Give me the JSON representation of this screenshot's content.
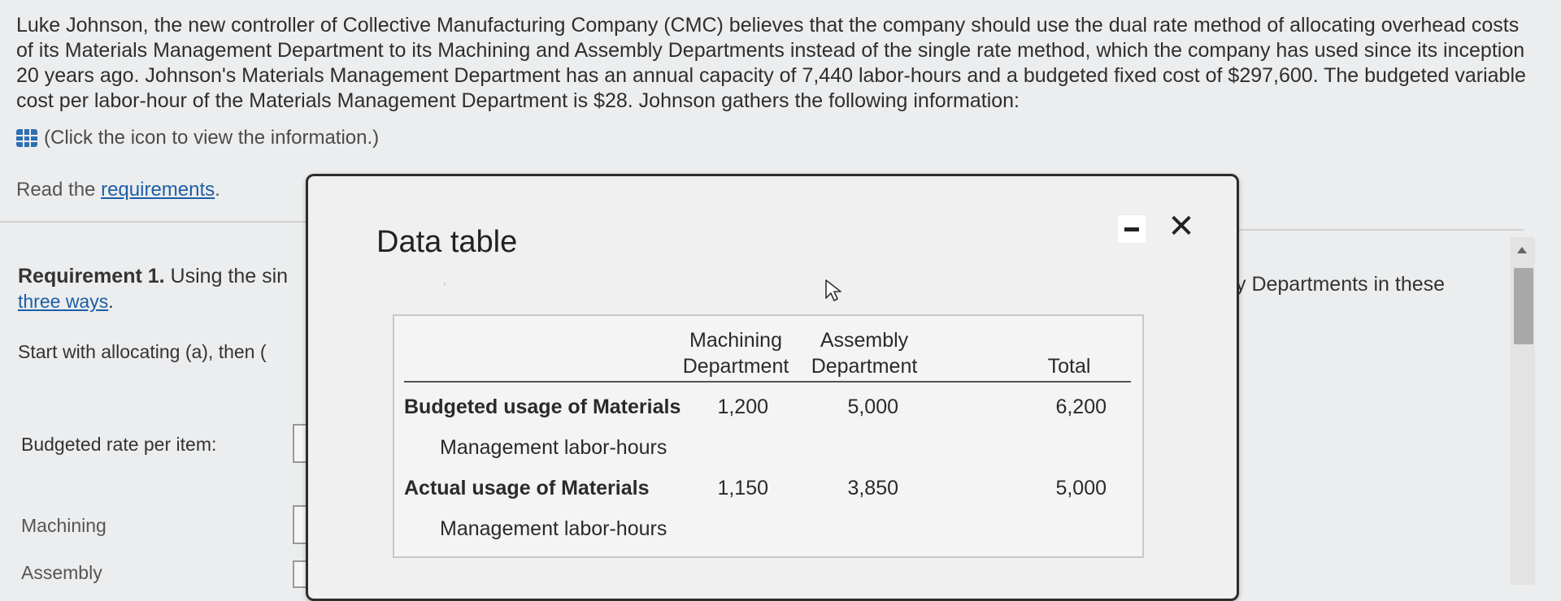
{
  "problem": {
    "text": "Luke Johnson, the new controller of Collective Manufacturing Company (CMC) believes that the company should use the dual rate method of allocating overhead costs of its Materials Management Department to its Machining and Assembly Departments instead of the single rate method, which the company has used since its inception 20 years ago. Johnson's Materials Management Department has an annual capacity of 7,440 labor-hours and a budgeted fixed cost of $297,600. The budgeted variable cost per labor-hour of the Materials Management Department is $28. Johnson gathers the following information:",
    "info_link": "(Click the icon to view the information.)"
  },
  "read": {
    "prefix": "Read the ",
    "link": "requirements",
    "suffix": "."
  },
  "requirement": {
    "label": "Requirement 1.",
    "text": " Using the sin",
    "link": "three ways",
    "link_suffix": ".",
    "start": "Start with allocating (a), then ("
  },
  "labels": {
    "budgeted_rate": "Budgeted rate per item:",
    "machining": "Machining",
    "assembly": "Assembly"
  },
  "right_text": "y Departments in these",
  "modal": {
    "title": "Data table",
    "minimize": "minimize",
    "close": "✕",
    "columns": {
      "machining": [
        "Machining",
        "Department"
      ],
      "assembly": [
        "Assembly",
        "Department"
      ],
      "total": "Total"
    },
    "rows": [
      {
        "label1": "Budgeted usage of Materials",
        "label2": "Management labor-hours",
        "machining": "1,200",
        "assembly": "5,000",
        "total": "6,200"
      },
      {
        "label1": "Actual usage of Materials",
        "label2": "Management labor-hours",
        "machining": "1,150",
        "assembly": "3,850",
        "total": "5,000"
      }
    ]
  },
  "icons": {
    "info": "table-grid-icon",
    "cursor": "mouse-pointer-icon",
    "scroll_up": "scroll-up-arrow-icon"
  }
}
